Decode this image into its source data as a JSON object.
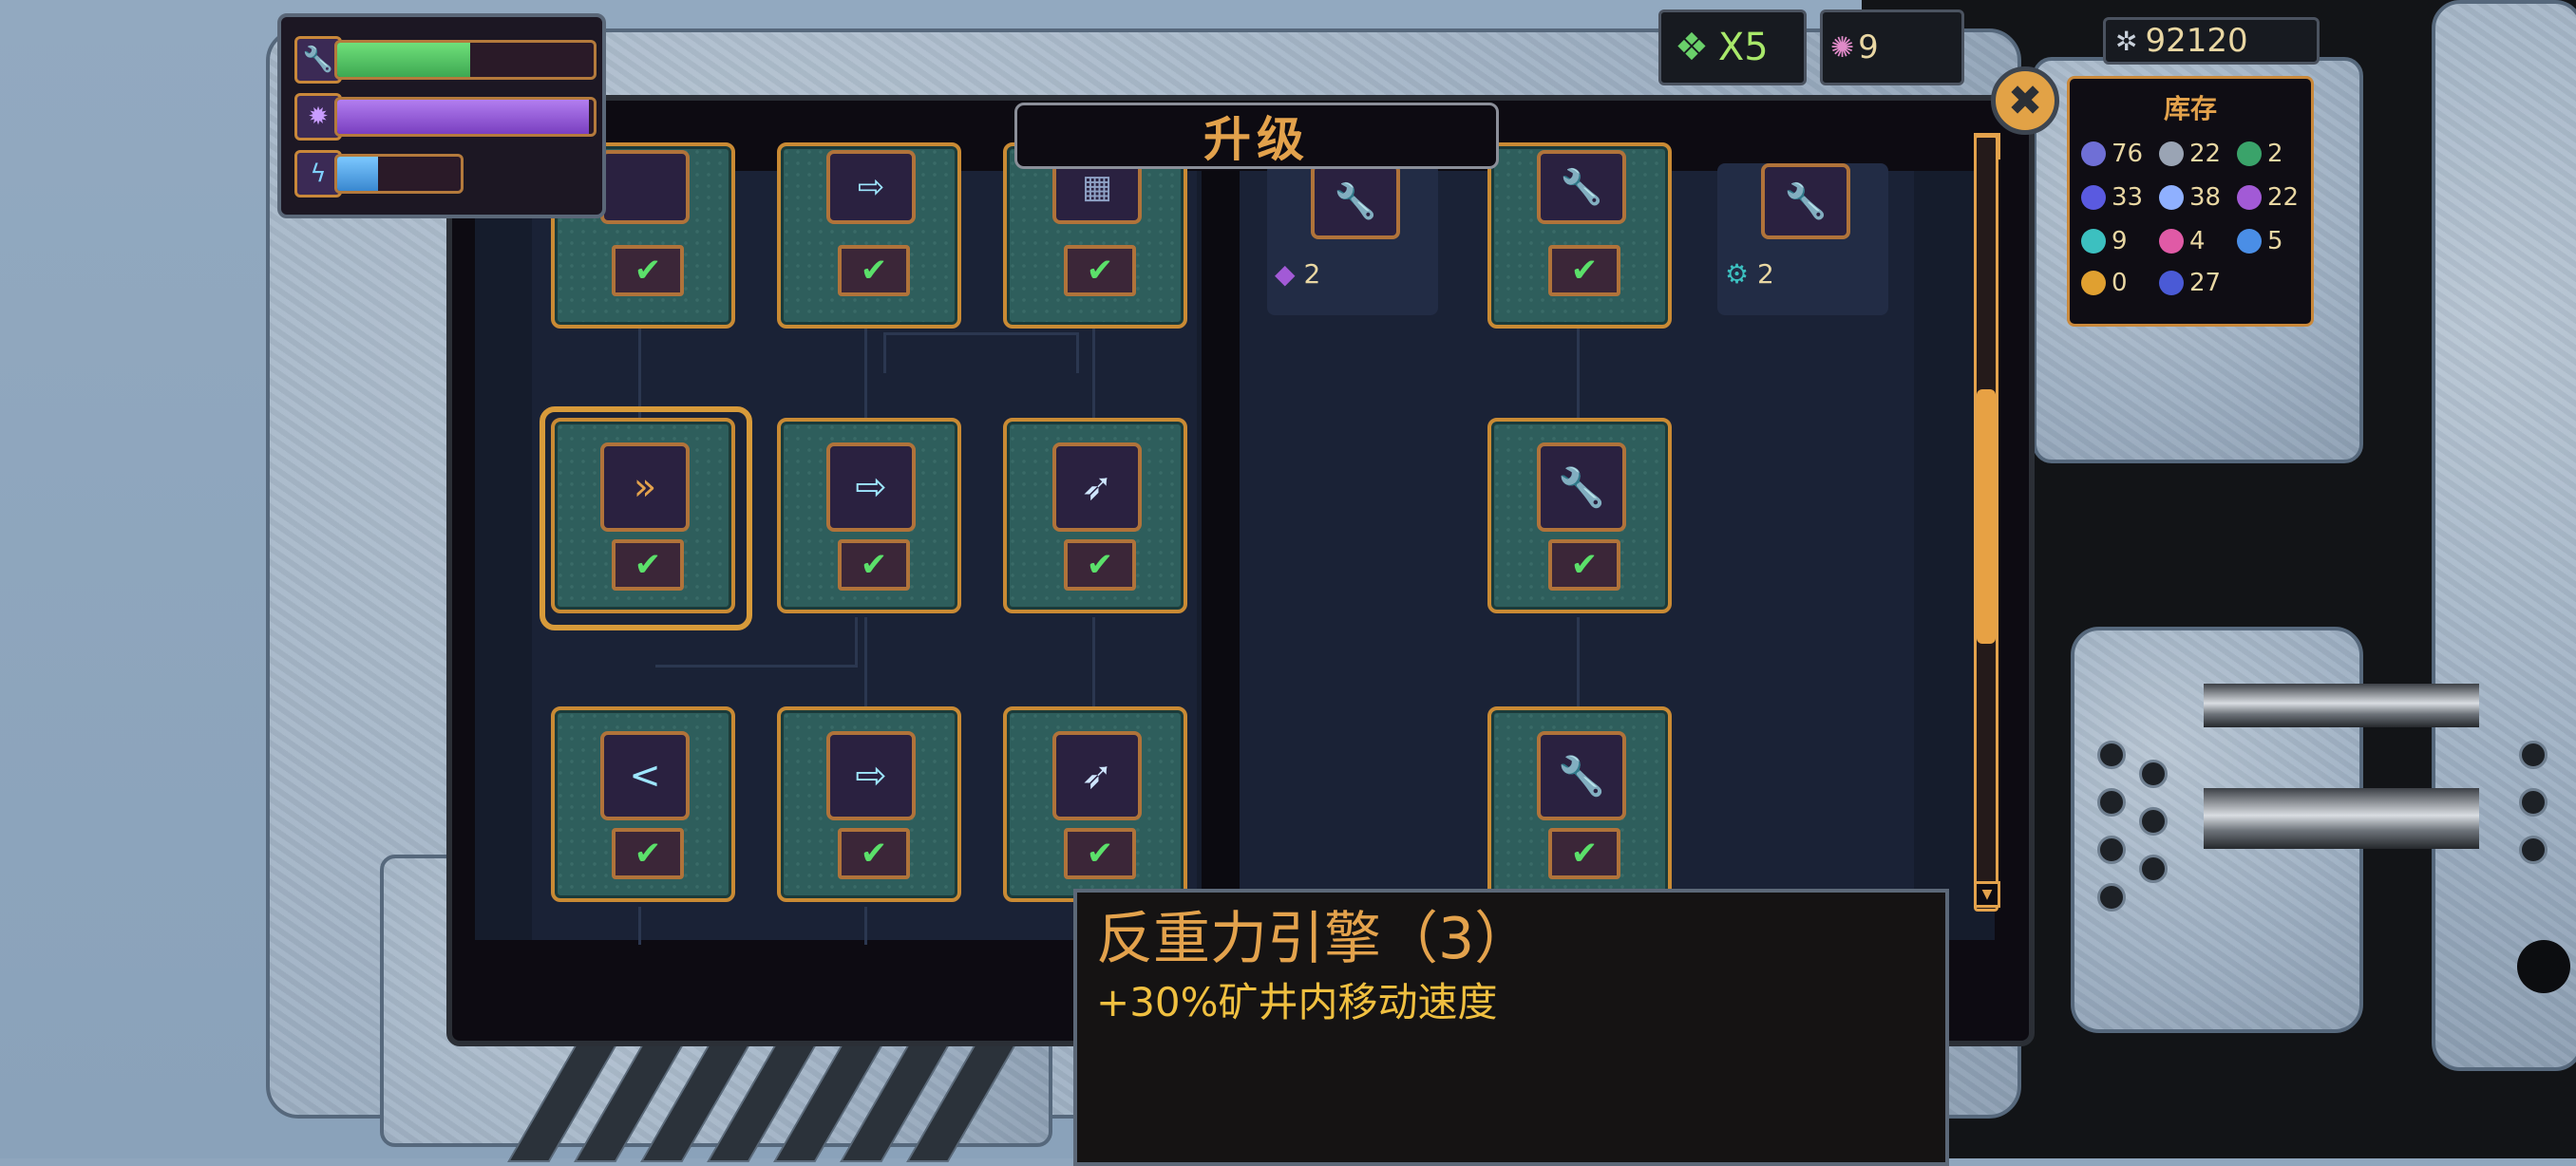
{
  "title": "升级",
  "hud": {
    "bars": [
      {
        "icon": "wrench-icon",
        "fill": 0.52,
        "color": "#55c865"
      },
      {
        "icon": "sawblade-icon",
        "fill": 0.98,
        "color": "#9a5ad8"
      },
      {
        "icon": "lightning-icon",
        "fill": 0.33,
        "color": "#4aa6e6"
      }
    ]
  },
  "currency": {
    "keys": "X5",
    "gems": "9",
    "money": "92120"
  },
  "inventory": {
    "title": "库存",
    "items": [
      {
        "icon": "iron-ore-icon",
        "color": "#6f6fd6",
        "count": "76"
      },
      {
        "icon": "crystal-shard-icon",
        "color": "#9aa4b4",
        "count": "22"
      },
      {
        "icon": "green-crystal-icon",
        "color": "#3aa36a",
        "count": "2"
      },
      {
        "icon": "blue-cluster-icon",
        "color": "#5a5ae0",
        "count": "33"
      },
      {
        "icon": "spark-icon",
        "color": "#8fb0ff",
        "count": "38"
      },
      {
        "icon": "purple-crystal-icon",
        "color": "#a25ad6",
        "count": "22"
      },
      {
        "icon": "teal-gear-icon",
        "color": "#3cc0c0",
        "count": "9"
      },
      {
        "icon": "pink-coil-icon",
        "color": "#e05aa6",
        "count": "4"
      },
      {
        "icon": "blue-cube-icon",
        "color": "#4a8ee6",
        "count": "5"
      },
      {
        "icon": "gold-nugget-icon",
        "color": "#e0a030",
        "count": "0"
      },
      {
        "icon": "dark-shard-icon",
        "color": "#4a5ad6",
        "count": "27"
      }
    ]
  },
  "cost_cards": [
    {
      "icon": "purple-crystal-icon",
      "amount": "2"
    },
    {
      "icon": "teal-gear-icon",
      "amount": "2"
    }
  ],
  "tooltip": {
    "name": "反重力引擎（3）",
    "description": "+30%矿井内移动速度"
  },
  "colors": {
    "accent": "#e3a24c",
    "check": "#5be06a",
    "node_bg": "#2e5e5c"
  }
}
